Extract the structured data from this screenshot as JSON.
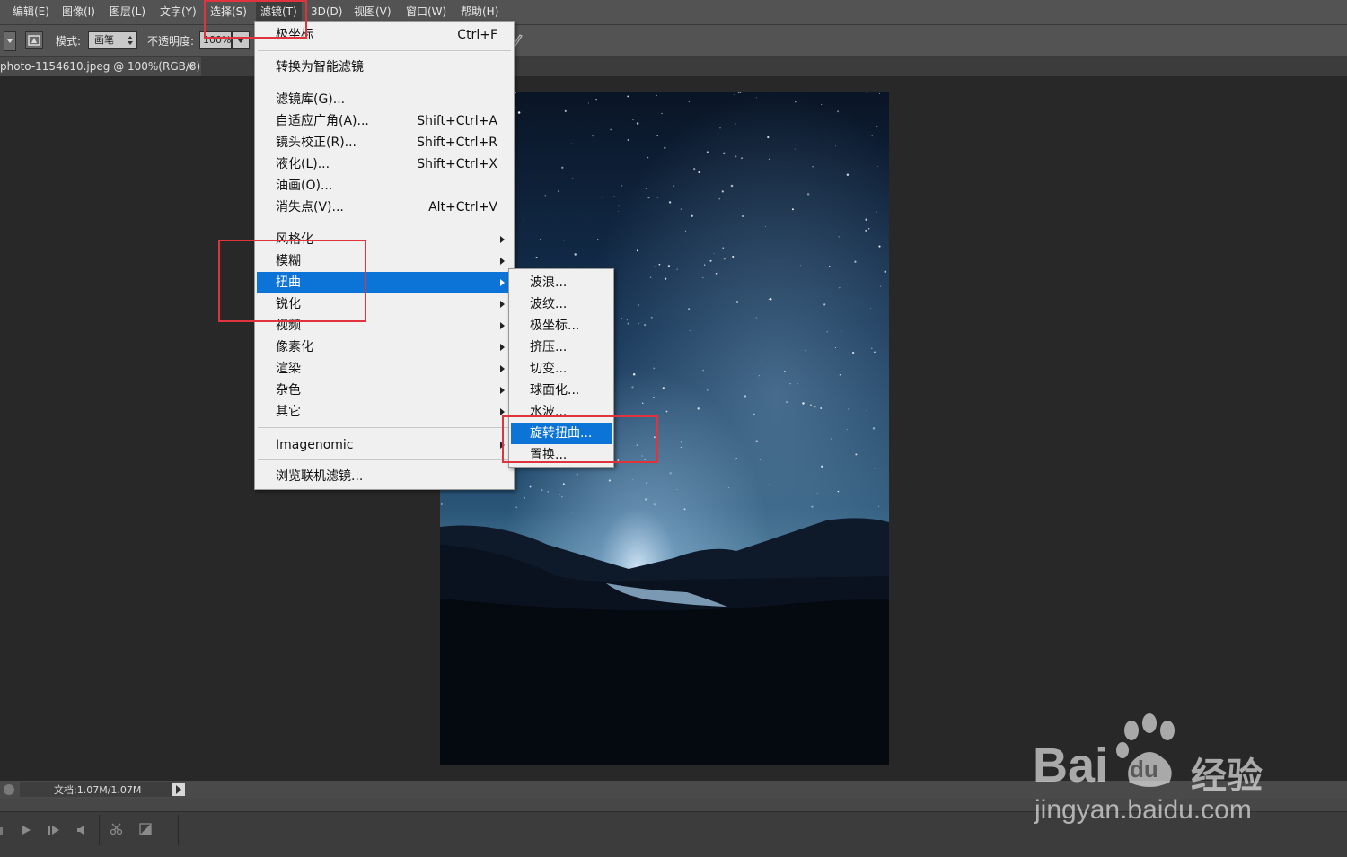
{
  "menubar": {
    "items": [
      "编辑(E)",
      "图像(I)",
      "图层(L)",
      "文字(Y)",
      "选择(S)",
      "滤镜(T)",
      "3D(D)",
      "视图(V)",
      "窗口(W)",
      "帮助(H)"
    ]
  },
  "options_bar": {
    "mode_label": "模式:",
    "mode_value": "画笔",
    "opacity_label": "不透明度:",
    "opacity_value": "100%"
  },
  "document": {
    "tab_title": "photo-1154610.jpeg @ 100%(RGB/8)",
    "close_glyph": "×"
  },
  "status": {
    "doc_size": "文档:1.07M/1.07M"
  },
  "filter_menu": {
    "last_filter": "极坐标",
    "last_filter_shortcut": "Ctrl+F",
    "convert_smart": "转换为智能滤镜",
    "gallery": "滤镜库(G)...",
    "adaptive_wide": "自适应广角(A)...",
    "adaptive_wide_shortcut": "Shift+Ctrl+A",
    "lens_correction": "镜头校正(R)...",
    "lens_correction_shortcut": "Shift+Ctrl+R",
    "liquify": "液化(L)...",
    "liquify_shortcut": "Shift+Ctrl+X",
    "oil_paint": "油画(O)...",
    "vanishing_point": "消失点(V)...",
    "vanishing_point_shortcut": "Alt+Ctrl+V",
    "stylize": "风格化",
    "blur": "模糊",
    "distort": "扭曲",
    "sharpen": "锐化",
    "video": "视频",
    "pixelate": "像素化",
    "render": "渲染",
    "noise": "杂色",
    "other": "其它",
    "imagenomic": "Imagenomic",
    "browse_online": "浏览联机滤镜..."
  },
  "distort_submenu": {
    "items": [
      "波浪...",
      "波纹...",
      "极坐标...",
      "挤压...",
      "切变...",
      "球面化...",
      "水波...",
      "旋转扭曲...",
      "置换..."
    ]
  },
  "watermark": {
    "brand_left": "Bai",
    "brand_right": "经验",
    "paw_text": "du",
    "url": "jingyan.baidu.com"
  },
  "colors": {
    "highlight": "#0c74d6",
    "annotation": "#e0333c"
  }
}
